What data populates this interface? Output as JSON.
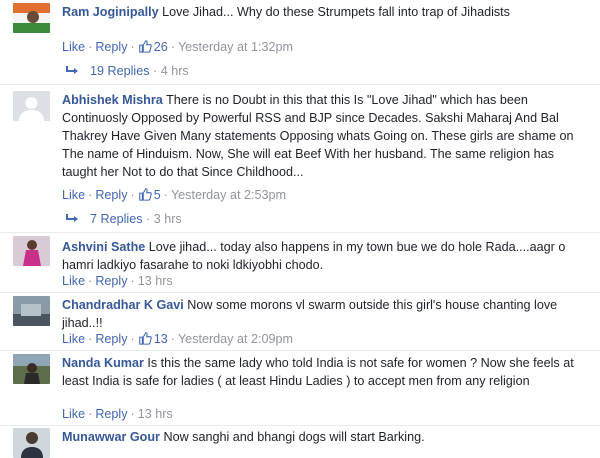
{
  "comments": [
    {
      "author": "Ram Joginipally",
      "text": "Love Jihad... Why do these Strumpets fall into trap of Jihadists",
      "like": "Like",
      "reply": "Reply",
      "likes": "26",
      "time": "Yesterday at 1:32pm",
      "replies_label": "19 Replies",
      "replies_time": "4 hrs"
    },
    {
      "author": "Abhishek Mishra",
      "text": "There is no Doubt in this that this Is \"Love Jihad\" which has been Continuosly Opposed by Powerful RSS and BJP since Decades. Sakshi Maharaj And Bal Thakrey Have Given Many statements Opposing whats Going on. These girls are shame on The name of Hinduism. Now, She will eat Beef With her husband. The same religion has taught her Not to do that Since Childhood...",
      "like": "Like",
      "reply": "Reply",
      "likes": "5",
      "time": "Yesterday at 2:53pm",
      "replies_label": "7 Replies",
      "replies_time": "3 hrs"
    },
    {
      "author": "Ashvini Sathe",
      "text": "Love jihad... today also happens in my town bue we do hole Rada....aagr o hamri ladkiyo fasarahe to noki ldkiyobhi chodo.",
      "like": "Like",
      "reply": "Reply",
      "time": "13 hrs"
    },
    {
      "author": "Chandradhar K Gavi",
      "text": "Now some morons vl swarm outside this girl's house chanting love jihad..!!",
      "like": "Like",
      "reply": "Reply",
      "likes": "13",
      "time": "Yesterday at 2:09pm"
    },
    {
      "author": "Nanda Kumar",
      "text": "Is this the same lady who told India is not safe for women ? Now she feels at least India is safe for ladies ( at least Hindu Ladies ) to accept men from any religion",
      "like": "Like",
      "reply": "Reply",
      "time": "13 hrs"
    },
    {
      "author": "Munawwar Gour",
      "text": "Now sanghi and bhangi dogs will start Barking."
    }
  ],
  "colors": {
    "author": "#365899",
    "link": "#4267b2",
    "meta": "#90949c",
    "text": "#1d2129"
  }
}
